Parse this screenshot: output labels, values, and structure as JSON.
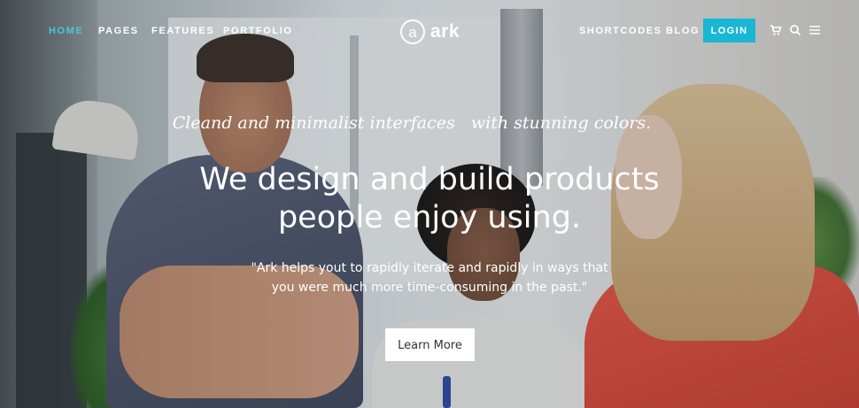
{
  "nav": {
    "left_items": [
      {
        "label": "HOME",
        "active": true
      },
      {
        "label": "PAGES",
        "active": false
      },
      {
        "label": "FEATURES",
        "active": false
      },
      {
        "label": "PORTFOLIO",
        "active": false
      }
    ],
    "right_items": [
      {
        "label": "SHORTCODES"
      },
      {
        "label": "BLOG"
      }
    ],
    "login_label": "LOGIN",
    "icons": [
      "cart-icon",
      "search-icon",
      "menu-icon"
    ]
  },
  "logo": {
    "mark": "a",
    "name": "ark"
  },
  "hero": {
    "tagline": "Cleand and minimalist interfaces   with stunning colors.",
    "headline_line1": "We design and build products",
    "headline_line2": "people enjoy using.",
    "subtext_line1": "\"Ark helps yout to rapidly iterate and rapidly in ways that",
    "subtext_line2": "you were much more time-consuming in the past.\"",
    "cta_label": "Learn More"
  },
  "colors": {
    "accent": "#18b7d3",
    "active_nav": "#48c6de",
    "text": "#ffffff"
  }
}
